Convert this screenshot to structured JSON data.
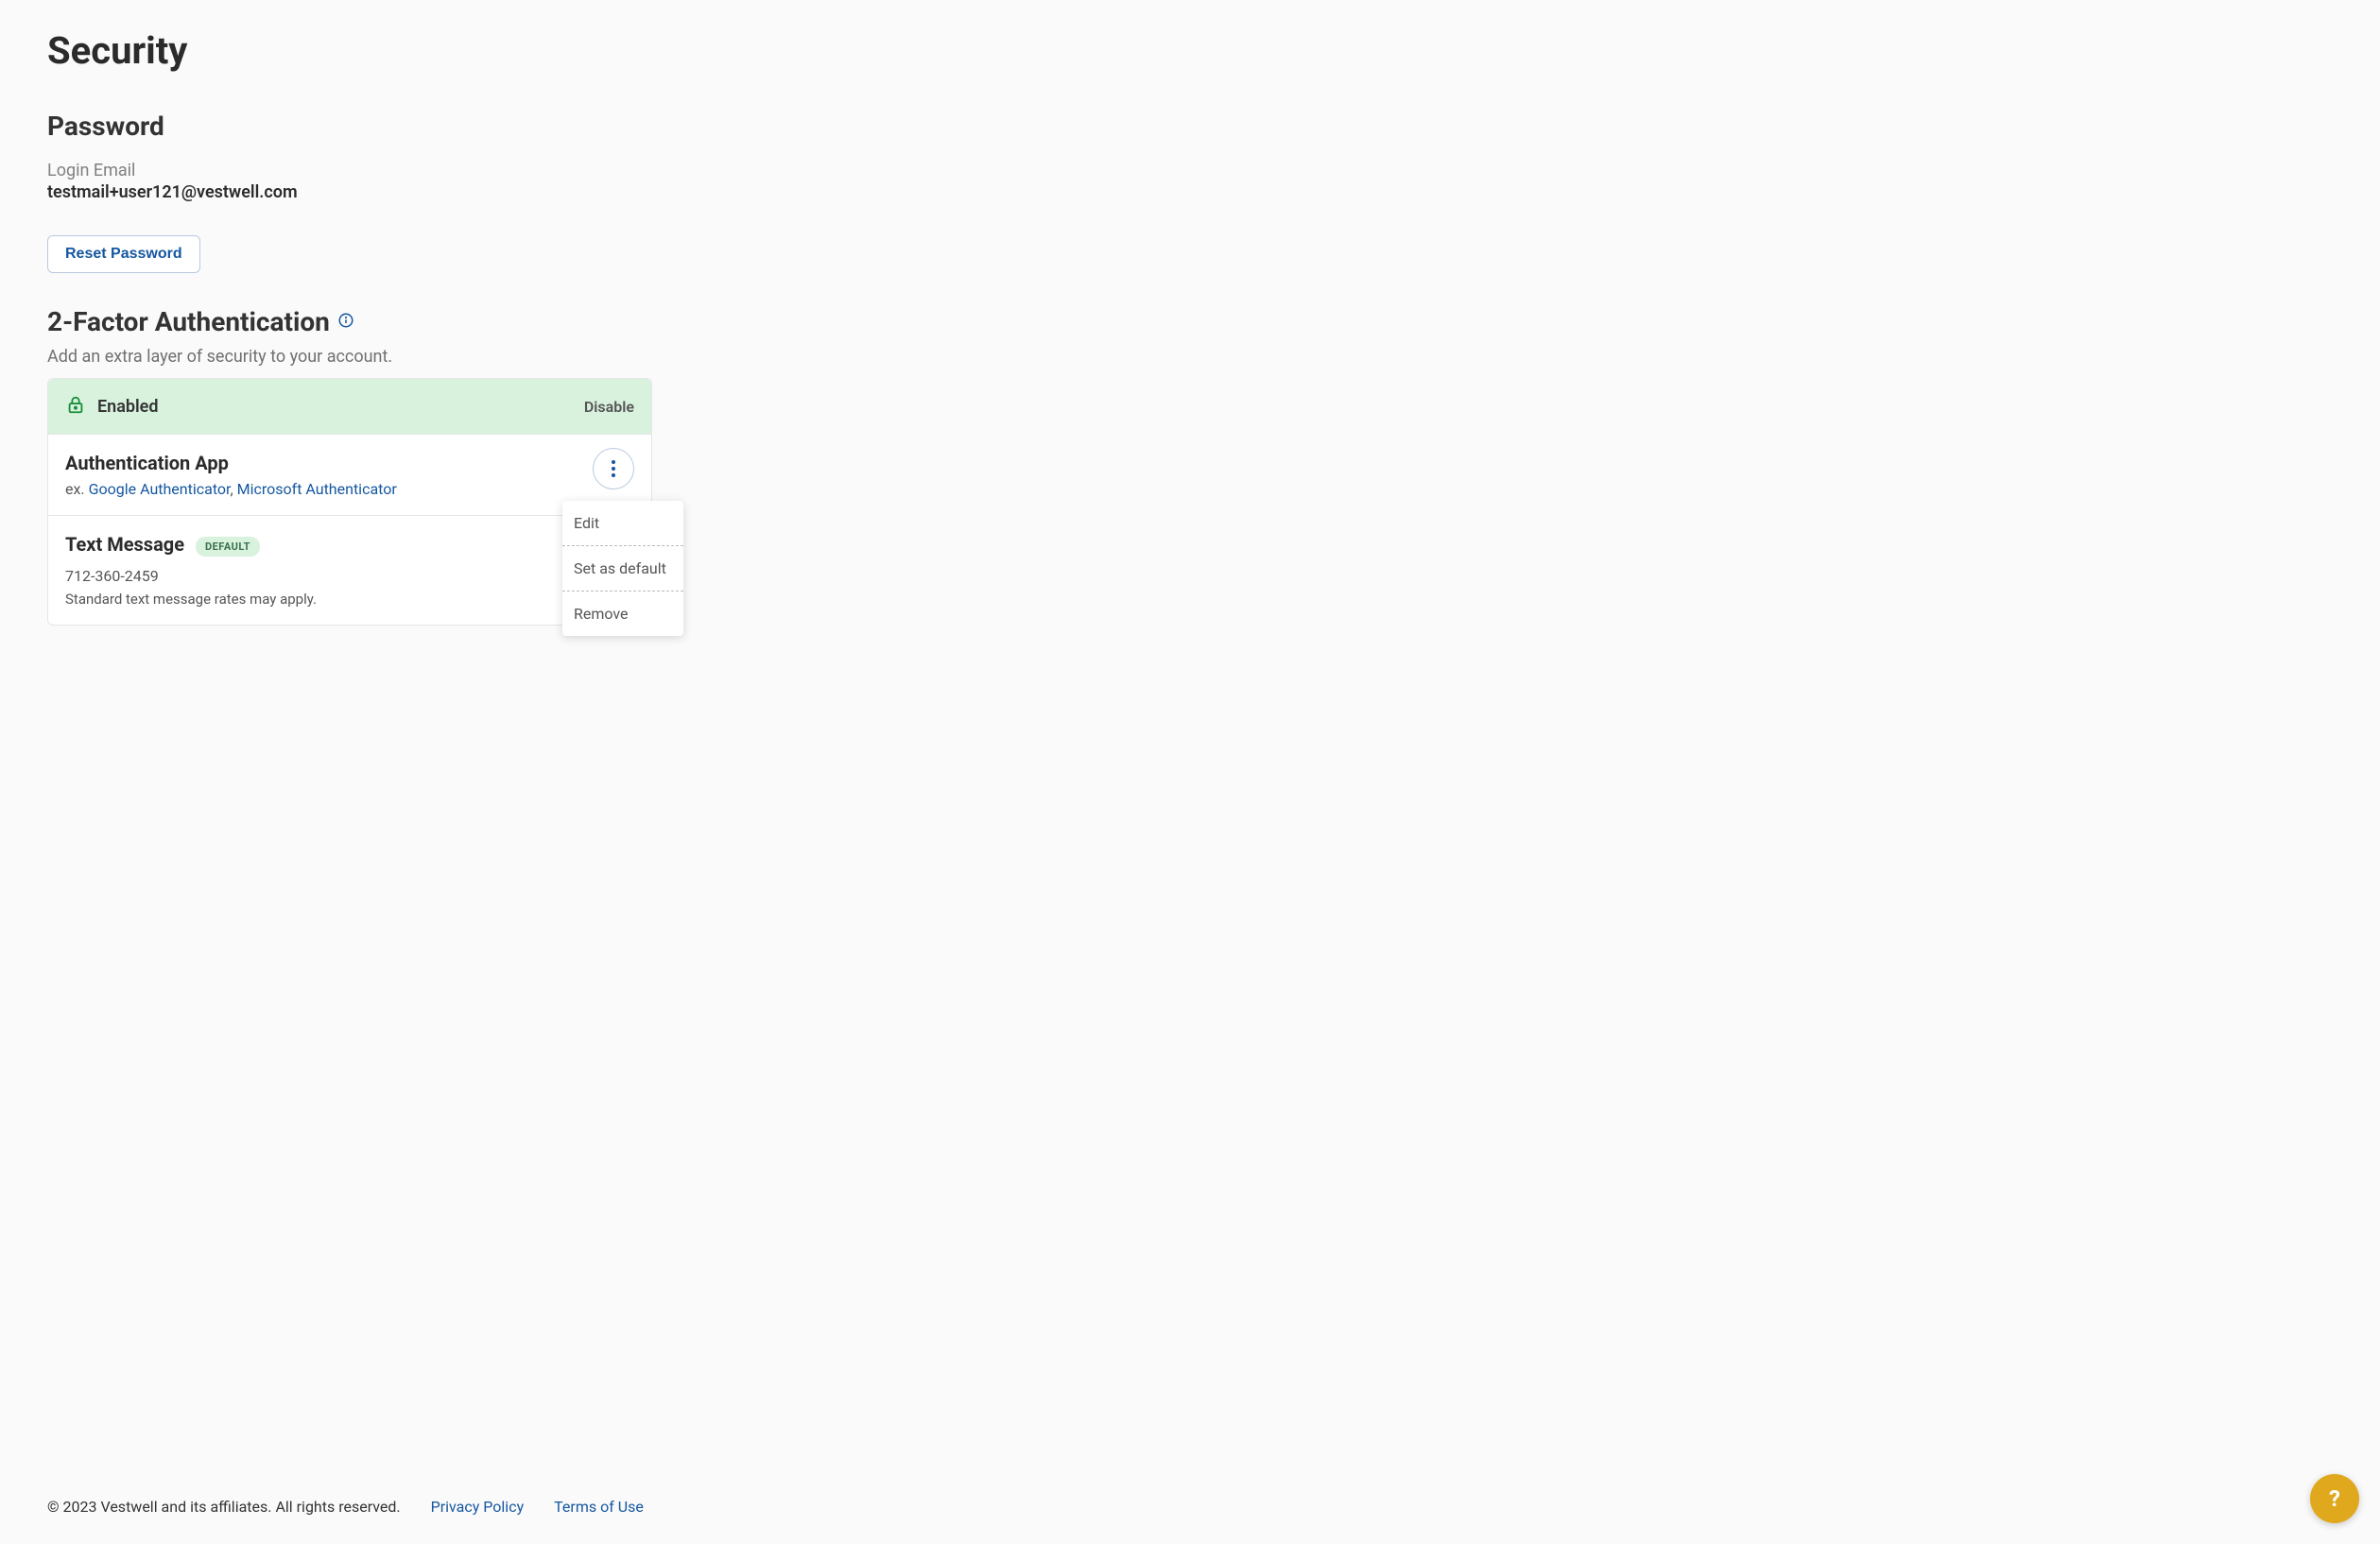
{
  "page": {
    "title": "Security"
  },
  "password": {
    "section_title": "Password",
    "login_email_label": "Login Email",
    "login_email_value": "testmail+user121@vestwell.com",
    "reset_button": "Reset Password"
  },
  "twofa": {
    "section_title": "2-Factor Authentication",
    "subtitle": "Add an extra layer of security to your account.",
    "status_label": "Enabled",
    "disable_label": "Disable",
    "auth_app": {
      "title": "Authentication App",
      "ex_prefix": "ex. ",
      "link1": "Google Authenticator",
      "separator": ", ",
      "link2": "Microsoft Authenticator"
    },
    "text_message": {
      "title": "Text Message",
      "default_badge": "DEFAULT",
      "phone": "712-360-2459",
      "note": "Standard text message rates may apply."
    },
    "menu": {
      "edit": "Edit",
      "set_default": "Set as default",
      "remove": "Remove"
    }
  },
  "footer": {
    "copyright": "© 2023 Vestwell and its affiliates. All rights reserved.",
    "privacy": "Privacy Policy",
    "terms": "Terms of Use"
  },
  "help": {
    "symbol": "?"
  }
}
